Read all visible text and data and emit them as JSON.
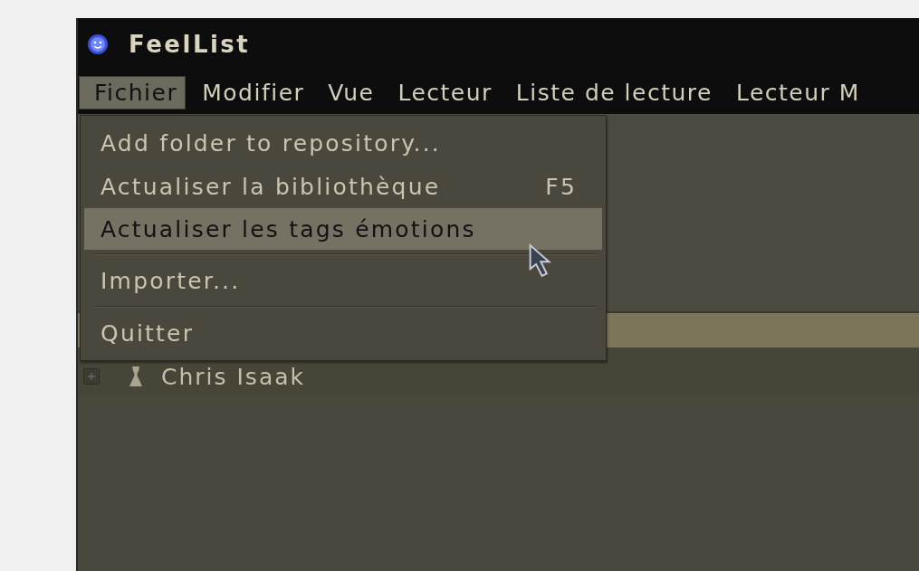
{
  "window": {
    "title": "FeelList"
  },
  "menu_bar": [
    {
      "label": "Fichier",
      "selected": true
    },
    {
      "label": "Modifier",
      "selected": false
    },
    {
      "label": "Vue",
      "selected": false
    },
    {
      "label": "Lecteur",
      "selected": false
    },
    {
      "label": "Liste de lecture",
      "selected": false
    },
    {
      "label": "Lecteur M",
      "selected": false
    }
  ],
  "open_menu": {
    "items": [
      {
        "kind": "item",
        "label": "Add folder to repository...",
        "selected": false
      },
      {
        "kind": "item",
        "label": "Actualiser la bibliothèque",
        "shortcut": "F5",
        "selected": false
      },
      {
        "kind": "item",
        "label": "Actualiser les tags émotions",
        "selected": true
      },
      {
        "kind": "separator"
      },
      {
        "kind": "item",
        "label": "Importer...",
        "selected": false
      },
      {
        "kind": "separator"
      },
      {
        "kind": "item",
        "label": "Quitter",
        "selected": false
      }
    ]
  },
  "tree": [
    {
      "label": "Chris Isaak",
      "expanded": false
    }
  ]
}
